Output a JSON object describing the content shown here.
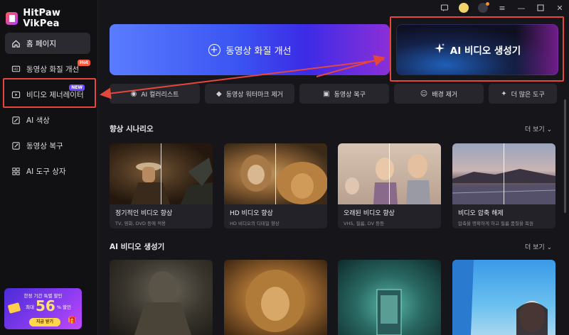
{
  "app": {
    "name": "HitPaw VikPea"
  },
  "sidebar": {
    "items": [
      {
        "label": "홈 페이지",
        "icon": "home-icon",
        "active": true
      },
      {
        "label": "동영상 화질 개선",
        "icon": "video-enhance-icon",
        "badge": "Hot"
      },
      {
        "label": "비디오 제너레이터",
        "icon": "video-generator-icon",
        "badge": "NEW"
      },
      {
        "label": "AI 색상",
        "icon": "color-icon"
      },
      {
        "label": "동영상 복구",
        "icon": "repair-icon"
      },
      {
        "label": "AI 도구 상자",
        "icon": "toolbox-icon"
      }
    ],
    "promo": {
      "title": "한정 기간 특별 할인",
      "max": "최대",
      "number": "56",
      "percent": "%",
      "off": "할인",
      "button": "지금 받기"
    }
  },
  "hero": {
    "enhance_label": "동영상 화질 개선",
    "ai_video_label": "AI 비디오 생성기"
  },
  "tools": [
    {
      "label": "AI 컬러리스트",
      "icon": "palette-icon"
    },
    {
      "label": "동영상 워터마크 제거",
      "icon": "eraser-icon"
    },
    {
      "label": "동영상 복구",
      "icon": "video-repair-icon"
    },
    {
      "label": "배경 제거",
      "icon": "background-remove-icon"
    },
    {
      "label": "더 많은 도구",
      "icon": "sparkle-icon"
    }
  ],
  "sections": {
    "scenarios": {
      "title": "향상 시나리오",
      "more": "더 보기"
    },
    "ai_video": {
      "title": "AI 비디오 생성기",
      "more": "더 보기"
    }
  },
  "scenario_cards": [
    {
      "title": "정기적인 비디오 향상",
      "sub": "TV, 영화, DVD 등에 적용"
    },
    {
      "title": "HD 비디오 향상",
      "sub": "HD 비디오의 디테일 향상"
    },
    {
      "title": "오래된 비디오 향상",
      "sub": "VHS, 필름, DV 등등"
    },
    {
      "title": "비디오 압축 해제",
      "sub": "압축을 명확하게 하고 필름 품질을 복원"
    }
  ],
  "colors": {
    "accent_red": "#e5473c",
    "hero_blue": "#3b55f2",
    "sidebar_bg": "#111114"
  }
}
